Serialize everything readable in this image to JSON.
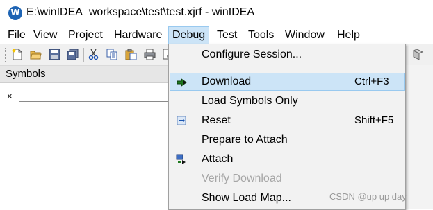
{
  "window": {
    "title": "E:\\winIDEA_workspace\\test\\test.xjrf - winIDEA",
    "app_icon": "winidea-logo-icon"
  },
  "menubar": {
    "items": [
      {
        "label": "File"
      },
      {
        "label": "View"
      },
      {
        "label": "Project"
      },
      {
        "label": "Hardware"
      },
      {
        "label": "Debug",
        "active": true
      },
      {
        "label": "Test"
      },
      {
        "label": "Tools"
      },
      {
        "label": "Window"
      },
      {
        "label": "Help"
      }
    ]
  },
  "toolbar": {
    "buttons": [
      "new-file-icon",
      "open-folder-icon",
      "save-icon",
      "save-all-icon",
      "cut-icon",
      "copy-icon",
      "paste-icon",
      "print-icon",
      "print-preview-icon"
    ]
  },
  "symbols_panel": {
    "title": "Symbols",
    "close_glyph": "×",
    "search_value": ""
  },
  "debug_menu": {
    "items": [
      {
        "label": "Configure Session...",
        "shortcut": "",
        "icon": null,
        "enabled": true,
        "highlighted": false
      },
      {
        "label": "Download",
        "shortcut": "Ctrl+F3",
        "icon": "download-icon",
        "enabled": true,
        "highlighted": true
      },
      {
        "label": "Load Symbols Only",
        "shortcut": "",
        "icon": null,
        "enabled": true,
        "highlighted": false
      },
      {
        "label": "Reset",
        "shortcut": "Shift+F5",
        "icon": "reset-icon",
        "enabled": true,
        "highlighted": false
      },
      {
        "label": "Prepare to Attach",
        "shortcut": "",
        "icon": null,
        "enabled": true,
        "highlighted": false
      },
      {
        "label": "Attach",
        "shortcut": "",
        "icon": "attach-icon",
        "enabled": true,
        "highlighted": false
      },
      {
        "label": "Verify Download",
        "shortcut": "",
        "icon": null,
        "enabled": false,
        "highlighted": false
      },
      {
        "label": "Show Load Map...",
        "shortcut": "",
        "icon": null,
        "enabled": true,
        "highlighted": false
      }
    ]
  },
  "watermark": {
    "text": "CSDN @up up day"
  },
  "colors": {
    "highlight": "#cce4f7",
    "highlight_border": "#99c9ef",
    "menu_bg": "#f2f2f2",
    "disabled_text": "#a6a6a6"
  }
}
